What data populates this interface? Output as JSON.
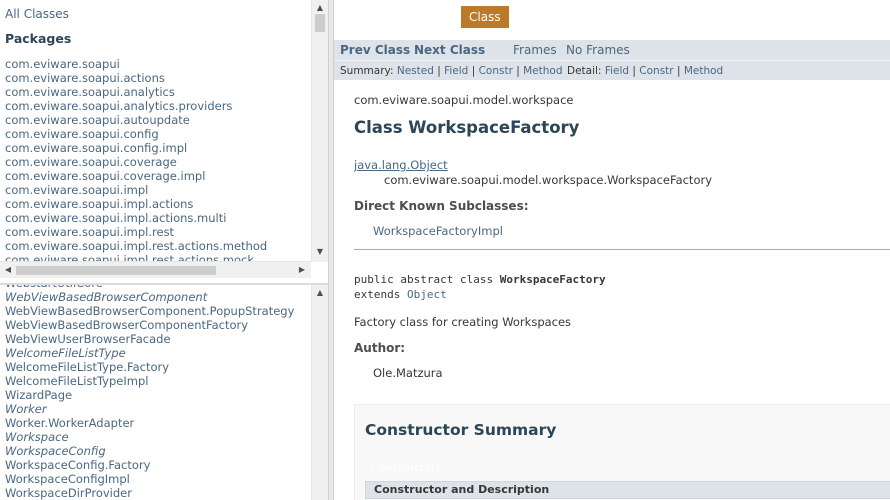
{
  "left_top": {
    "all_classes": "All Classes",
    "packages_heading": "Packages",
    "packages": [
      "com.eviware.soapui",
      "com.eviware.soapui.actions",
      "com.eviware.soapui.analytics",
      "com.eviware.soapui.analytics.providers",
      "com.eviware.soapui.autoupdate",
      "com.eviware.soapui.config",
      "com.eviware.soapui.config.impl",
      "com.eviware.soapui.coverage",
      "com.eviware.soapui.coverage.impl",
      "com.eviware.soapui.impl",
      "com.eviware.soapui.impl.actions",
      "com.eviware.soapui.impl.actions.multi",
      "com.eviware.soapui.impl.rest",
      "com.eviware.soapui.impl.rest.actions.method",
      "com.eviware.soapui.impl.rest.actions.mock"
    ]
  },
  "left_bottom": {
    "classes": [
      {
        "name": "WebstartUtilCore",
        "italic": false
      },
      {
        "name": "WebViewBasedBrowserComponent",
        "italic": true
      },
      {
        "name": "WebViewBasedBrowserComponent.PopupStrategy",
        "italic": false
      },
      {
        "name": "WebViewBasedBrowserComponentFactory",
        "italic": false
      },
      {
        "name": "WebViewUserBrowserFacade",
        "italic": false
      },
      {
        "name": "WelcomeFileListType",
        "italic": true
      },
      {
        "name": "WelcomeFileListType.Factory",
        "italic": false
      },
      {
        "name": "WelcomeFileListTypeImpl",
        "italic": false
      },
      {
        "name": "WizardPage",
        "italic": false
      },
      {
        "name": "Worker",
        "italic": true
      },
      {
        "name": "Worker.WorkerAdapter",
        "italic": false
      },
      {
        "name": "Workspace",
        "italic": true
      },
      {
        "name": "WorkspaceConfig",
        "italic": true
      },
      {
        "name": "WorkspaceConfig.Factory",
        "italic": false
      },
      {
        "name": "WorkspaceConfigImpl",
        "italic": false
      },
      {
        "name": "WorkspaceDirProvider",
        "italic": false
      }
    ]
  },
  "right": {
    "class_badge": "Class",
    "nav": {
      "prev_class": "Prev Class",
      "next_class": "Next Class",
      "frames": "Frames",
      "no_frames": "No Frames"
    },
    "subnav": {
      "summary_label": "Summary: ",
      "nested": "Nested",
      "field": "Field",
      "constr": "Constr",
      "method": "Method",
      "detail_label": "Detail: ",
      "d_field": "Field",
      "d_constr": "Constr",
      "d_method": "Method",
      "sep": " | "
    },
    "package_name": "com.eviware.soapui.model.workspace",
    "class_title": "Class WorkspaceFactory",
    "inheritance": [
      "java.lang.Object",
      "com.eviware.soapui.model.workspace.WorkspaceFactory"
    ],
    "subclasses_heading": "Direct Known Subclasses:",
    "subclass": "WorkspaceFactoryImpl",
    "decl": {
      "prefix": "public abstract class ",
      "name": "WorkspaceFactory",
      "extends": "extends ",
      "super": "Object"
    },
    "description": "Factory class for creating Workspaces",
    "author_heading": "Author:",
    "author": "Ole.Matzura",
    "constructor_summary": "Constructor Summary",
    "constructors_caption": "Constructors",
    "table_header": "Constructor and Description"
  },
  "colors": {
    "badge": "#bb7a2a",
    "nav_bg": "#dee3e9",
    "link": "#4a6782",
    "heading": "#2c4557"
  }
}
